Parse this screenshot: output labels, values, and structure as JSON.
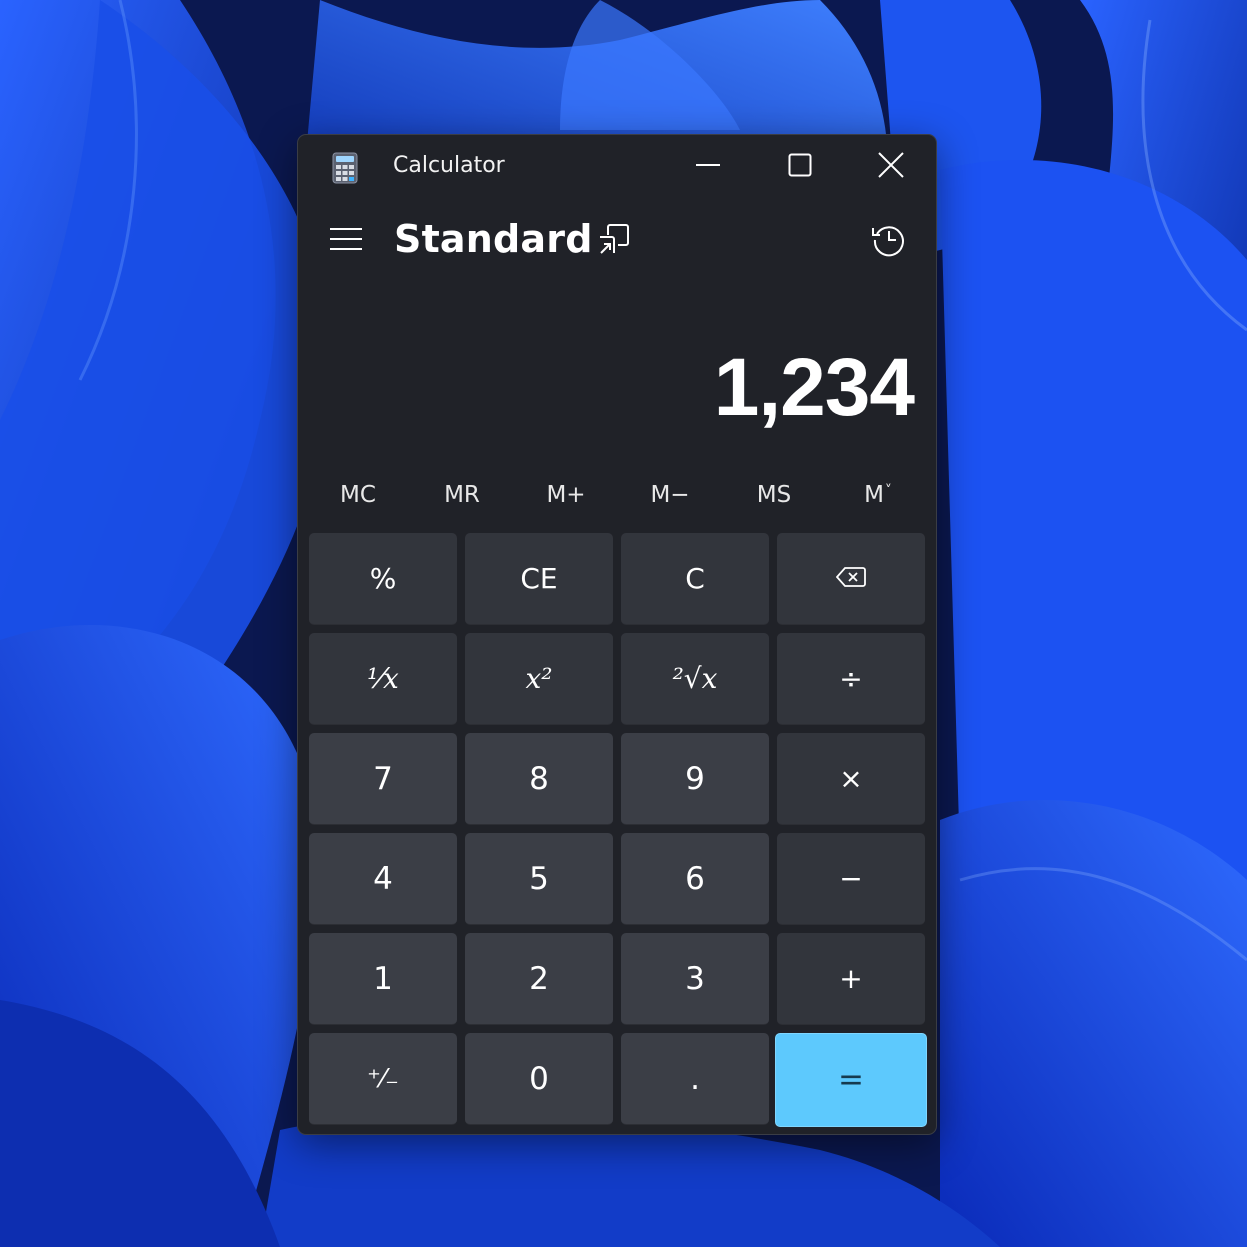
{
  "window": {
    "title": "Calculator",
    "controls": [
      "minimize-icon",
      "maximize-icon",
      "close-icon"
    ]
  },
  "header": {
    "menu_icon": "hamburger-icon",
    "mode": "Standard",
    "keep_on_top_icon": "keep-on-top-icon",
    "history_icon": "history-icon"
  },
  "display": {
    "value": "1,234"
  },
  "memory": {
    "buttons": [
      "MC",
      "MR",
      "M+",
      "M−",
      "MS",
      "M"
    ],
    "dropdown_marker": "˅"
  },
  "keypad": {
    "row1": [
      "%",
      "CE",
      "C",
      "backspace-icon"
    ],
    "row2": [
      "¹⁄x",
      "x²",
      "²√x",
      "÷"
    ],
    "row3": [
      "7",
      "8",
      "9",
      "×"
    ],
    "row4": [
      "4",
      "5",
      "6",
      "−"
    ],
    "row5": [
      "1",
      "2",
      "3",
      "+"
    ],
    "row6": [
      "⁺⁄₋",
      "0",
      ".",
      "="
    ]
  },
  "colors": {
    "window_bg": "#202228",
    "digit_key": "#3b3e46",
    "op_key": "#32353c",
    "equals_key": "#5dc9fd",
    "wallpaper_accent": "#1646e6"
  }
}
